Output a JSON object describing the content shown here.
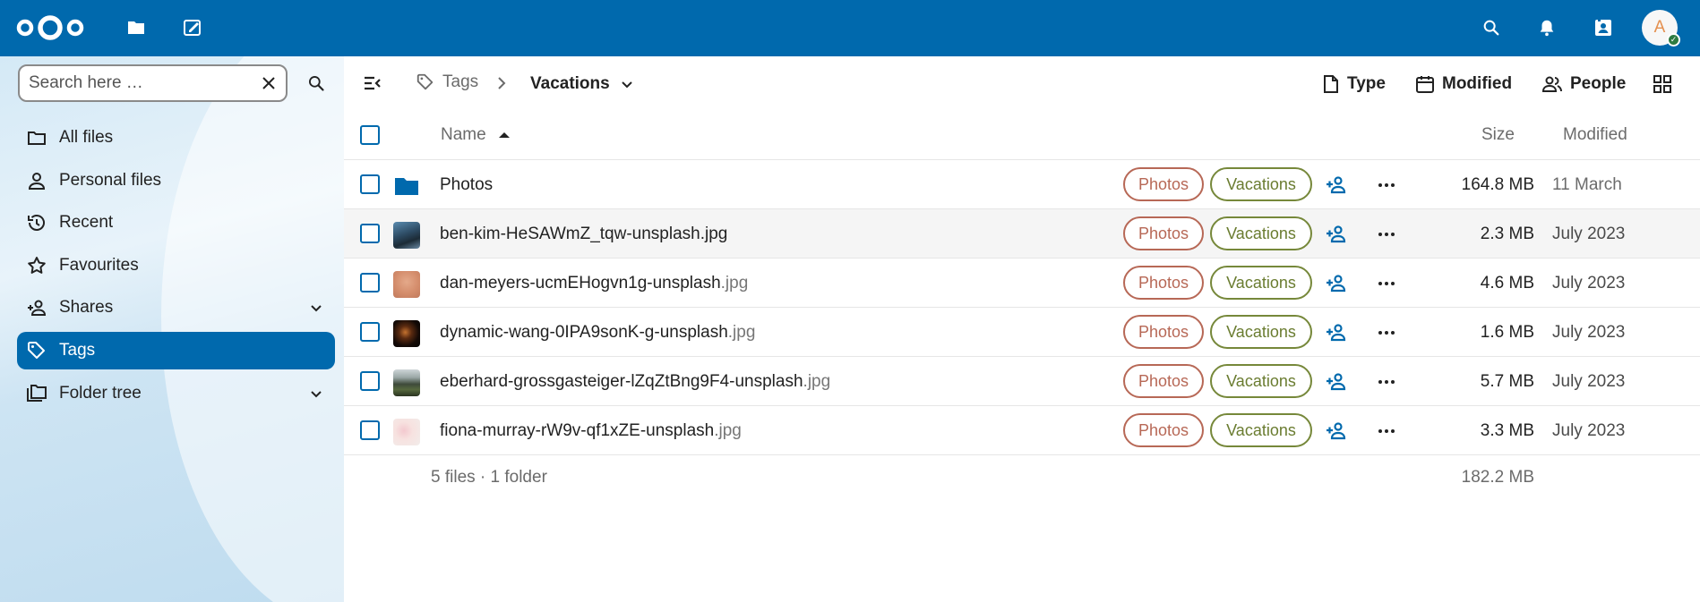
{
  "header": {
    "avatar_initial": "A"
  },
  "sidebar": {
    "search_placeholder": "Search here …",
    "items": [
      {
        "label": "All files",
        "icon": "folder-icon"
      },
      {
        "label": "Personal files",
        "icon": "person-icon"
      },
      {
        "label": "Recent",
        "icon": "history-icon"
      },
      {
        "label": "Favourites",
        "icon": "star-icon"
      },
      {
        "label": "Shares",
        "icon": "share-icon",
        "expandable": true
      },
      {
        "label": "Tags",
        "icon": "tag-icon",
        "active": true
      },
      {
        "label": "Folder tree",
        "icon": "folder-tree-icon",
        "expandable": true
      }
    ]
  },
  "toolbar": {
    "breadcrumb_parent": "Tags",
    "breadcrumb_current": "Vacations",
    "filters": {
      "type": "Type",
      "modified": "Modified",
      "people": "People"
    }
  },
  "table": {
    "headers": {
      "name": "Name",
      "size": "Size",
      "modified": "Modified"
    },
    "rows": [
      {
        "base": "Photos",
        "ext": "",
        "type": "folder",
        "tags": [
          "Photos",
          "Vacations"
        ],
        "size": "164.8 MB",
        "modified": "11 March"
      },
      {
        "base": "ben-kim-HeSAWmZ_tqw-unsplash.jpg",
        "ext": "",
        "type": "image",
        "tags": [
          "Photos",
          "Vacations"
        ],
        "size": "2.3 MB",
        "modified": "July 2023"
      },
      {
        "base": "dan-meyers-ucmEHogvn1g-unsplash",
        "ext": ".jpg",
        "type": "image",
        "tags": [
          "Photos",
          "Vacations"
        ],
        "size": "4.6 MB",
        "modified": "July 2023"
      },
      {
        "base": "dynamic-wang-0IPA9sonK-g-unsplash",
        "ext": ".jpg",
        "type": "image",
        "tags": [
          "Photos",
          "Vacations"
        ],
        "size": "1.6 MB",
        "modified": "July 2023"
      },
      {
        "base": "eberhard-grossgasteiger-lZqZtBng9F4-unsplash",
        "ext": ".jpg",
        "type": "image",
        "tags": [
          "Photos",
          "Vacations"
        ],
        "size": "5.7 MB",
        "modified": "July 2023"
      },
      {
        "base": "fiona-murray-rW9v-qf1xZE-unsplash",
        "ext": ".jpg",
        "type": "image",
        "tags": [
          "Photos",
          "Vacations"
        ],
        "size": "3.3 MB",
        "modified": "July 2023"
      }
    ],
    "summary": "5 files · 1 folder",
    "total_size": "182.2 MB"
  },
  "colors": {
    "primary": "#0069ad",
    "tag_photos": "#b76856",
    "tag_vacations": "#76883a",
    "avatar_status": "#2d7b41"
  }
}
